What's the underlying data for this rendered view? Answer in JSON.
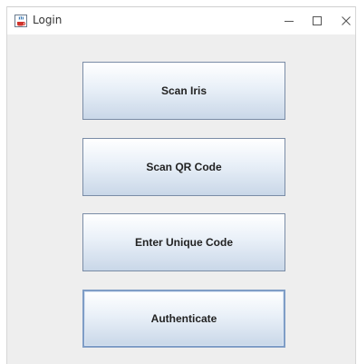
{
  "window": {
    "title": "Login",
    "app_icon": "java-coffee-cup-icon",
    "controls": [
      "minimize-icon",
      "maximize-icon",
      "close-icon"
    ]
  },
  "buttons": [
    {
      "label": "Scan Iris"
    },
    {
      "label": "Scan QR Code"
    },
    {
      "label": "Enter Unique Code"
    },
    {
      "label": "Authenticate"
    }
  ]
}
